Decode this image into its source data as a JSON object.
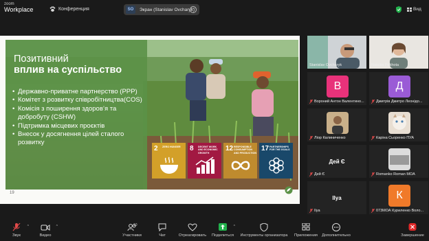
{
  "app": {
    "logo_line1": "zoom",
    "logo_line2": "Workplace"
  },
  "top": {
    "conference": "Конференция",
    "share_badge": "SO",
    "share_label": "Экран (Stanislav Ovcharyk)",
    "view_label": "Вид"
  },
  "slide": {
    "title_line1": "Позитивний",
    "title_line2": "вплив на суспільство",
    "bullets": [
      "Державно-приватне партнерство (PPP)",
      "Комітет з розвитку співробітництва(COS)",
      "Комісія з поширення здоров’я та добробуту (CSHW)",
      "Підтримка місцевих проєктів",
      "Внесок у досягнення цілей сталого розвитку"
    ],
    "page_number": "19",
    "sdg": [
      {
        "num": "2",
        "text": "ZERO HUNGER",
        "color": "#d3a029"
      },
      {
        "num": "8",
        "text": "DECENT WORK AND ECONOMIC GROWTH",
        "color": "#a21942"
      },
      {
        "num": "12",
        "text": "RESPONSIBLE CONSUMPTION AND PRODUCTION",
        "color": "#bf8b2e"
      },
      {
        "num": "17",
        "text": "PARTNERSHIPS FOR THE GOALS",
        "color": "#19486a"
      }
    ]
  },
  "participants": [
    {
      "name": "Stanislav Ovcharyk",
      "type": "video"
    },
    {
      "name": "Nataliia Pakhota",
      "type": "video"
    },
    {
      "name": "Вороний Антон Валентино...",
      "initial": "В",
      "color": "#e8327a"
    },
    {
      "name": "Дмитрів Дмитро Леонідо...",
      "initial": "Д",
      "color": "#9a5bd6"
    },
    {
      "name": "Лiор Калиниченко",
      "type": "photo"
    },
    {
      "name": "Каріна Сьоренко ПУА",
      "type": "photo"
    },
    {
      "name": "Дей Є",
      "label": "Дей Є"
    },
    {
      "name": "Romanko Roman МОА",
      "type": "photo"
    },
    {
      "name": "Ilya",
      "label": "Ilya"
    },
    {
      "name": "073МОА Куриленко Воло...",
      "initial": "К",
      "color": "#f07a2a"
    }
  ],
  "toolbar": {
    "audio": "Звук",
    "video": "Видео",
    "participants": "Участники",
    "participants_count": "10",
    "chat": "Чат",
    "react": "Отреагировать",
    "share": "Поделиться",
    "host_tools": "Инструменты организатора",
    "apps": "Приложения",
    "more": "Дополнительно",
    "end": "Завершение"
  },
  "colors": {
    "panel": "#5b9147",
    "share_green": "#22b14c",
    "end_red": "#e02828",
    "mic_red": "#e24a4a"
  }
}
